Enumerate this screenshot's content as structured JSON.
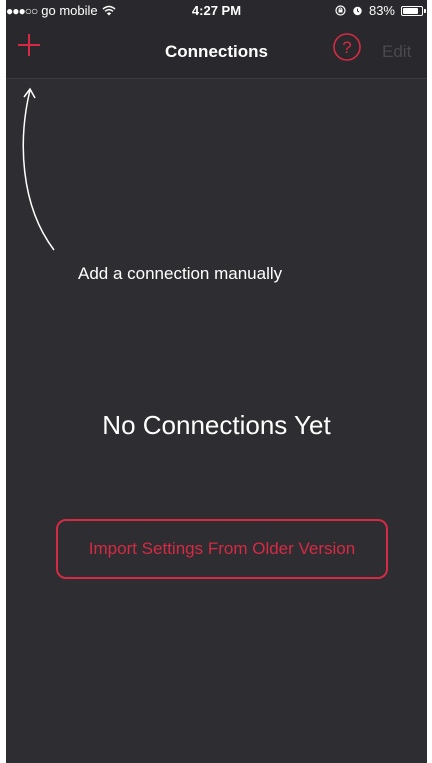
{
  "status_bar": {
    "signal": "●●●○○",
    "carrier": "go mobile",
    "time": "4:27 PM",
    "battery_percent": "83%",
    "battery_level": 0.83
  },
  "nav": {
    "title": "Connections",
    "edit_label": "Edit",
    "help_glyph": "?"
  },
  "main": {
    "hint": "Add a connection manually",
    "empty_title": "No Connections Yet",
    "import_button": "Import Settings From Older Version"
  },
  "colors": {
    "accent": "#d52a44",
    "background": "#2e2d31",
    "nav_background": "#29282c",
    "disabled_text": "#4a494e"
  },
  "icons": {
    "add": "plus-icon",
    "help": "question-circle-icon",
    "wifi": "wifi-icon",
    "lock_rotation": "rotation-lock-icon",
    "alarm": "alarm-icon",
    "battery": "battery-icon",
    "arrow": "curved-arrow-icon"
  }
}
